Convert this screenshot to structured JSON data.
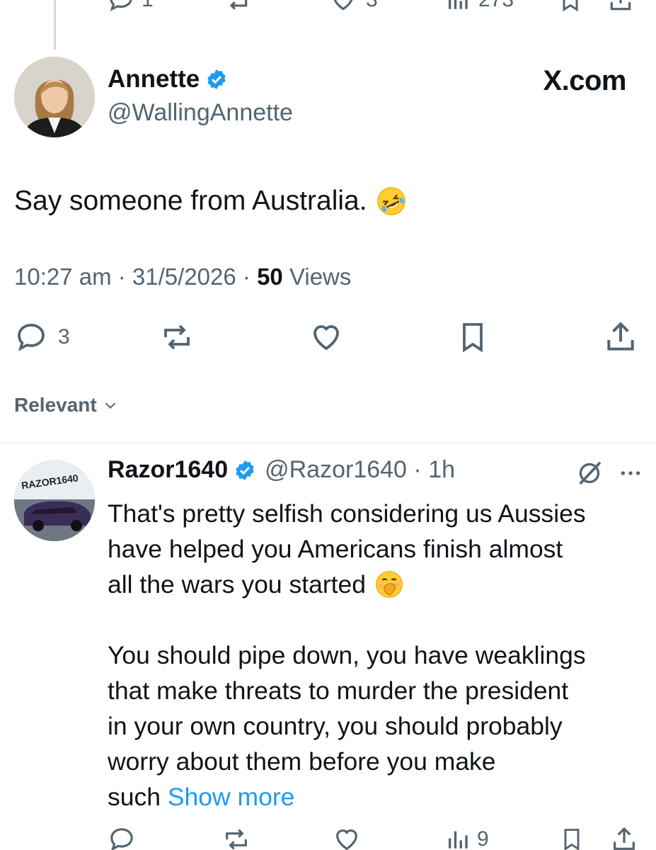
{
  "previous_tweet": {
    "reply_count": "1",
    "like_count": "3",
    "view_count": "273"
  },
  "tweet": {
    "author_name": "Annette",
    "author_handle": "@WallingAnnette",
    "brand": "X.com",
    "text": "Say someone from Australia.",
    "text_emoji": "rolling-on-floor-laughing",
    "time": "10:27 am",
    "date": "31/5/2026",
    "views_count": "50",
    "views_label": "Views",
    "reply_count": "3"
  },
  "sort": {
    "label": "Relevant"
  },
  "reply": {
    "author_name": "Razor1640",
    "author_handle": "@Razor1640",
    "age": "1h",
    "avatar_text": "RAZOR1640",
    "lines_para1": [
      "That's pretty selfish considering us Aussies",
      "have helped you Americans finish almost",
      "all the wars you started"
    ],
    "para1_emoji": "face-with-hand-over-mouth",
    "lines_para2": [
      "You should pipe down, you have weaklings",
      "that make threats to murder the president",
      "in your own country, you should probably",
      "worry about them before you make"
    ],
    "last_word": "such",
    "show_more": "Show more",
    "view_count": "9"
  },
  "colors": {
    "text": "#0f1419",
    "secondary": "#536471",
    "accent": "#1d9bf0",
    "divider": "#eff3f4"
  }
}
